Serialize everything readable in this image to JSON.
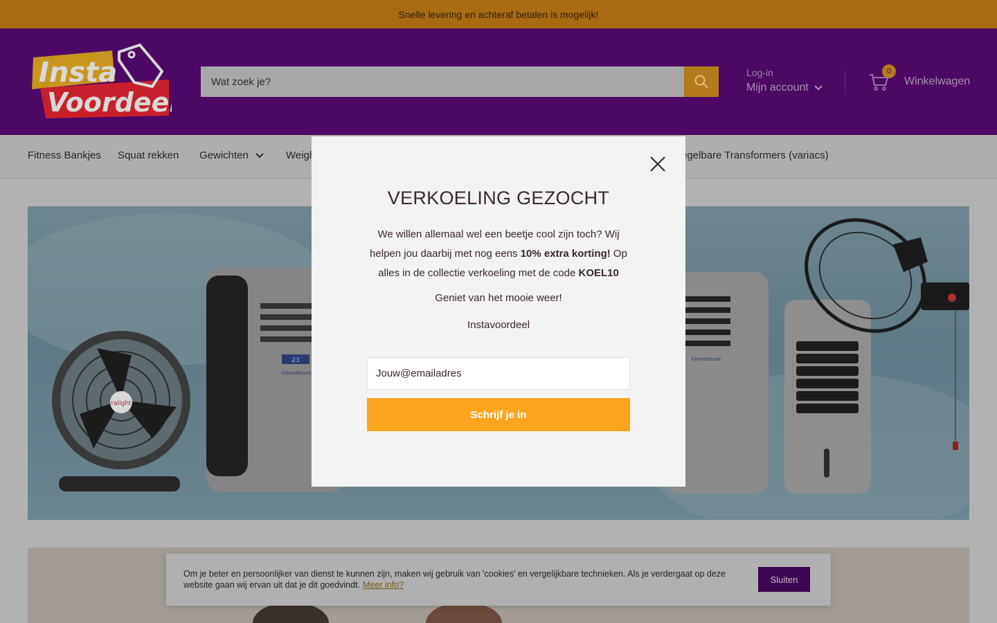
{
  "announcement": "Snelle levering en achteraf betalen is mogelijk!",
  "header": {
    "logo_top": "Insta",
    "logo_bottom": "Voordeel",
    "search_placeholder": "Wat zoek je?",
    "account_login": "Log-in",
    "account_label": "Mijn account",
    "cart_count": "0",
    "cart_label": "Winkelwagen"
  },
  "nav": {
    "items": [
      {
        "label": "Fitness Bankjes"
      },
      {
        "label": "Squat rekken"
      },
      {
        "label": "Gewichten"
      },
      {
        "label": "Weigh"
      },
      {
        "label": "egelbare Transformers (variacs)"
      }
    ]
  },
  "modal": {
    "title": "VERKOELING GEZOCHT",
    "body_1": "We willen allemaal wel een beetje cool zijn toch? Wij helpen jou daarbij met nog eens ",
    "body_bold": "10% extra korting!",
    "body_2": " Op alles in de collectie verkoeling met de code ",
    "code": "KOEL10",
    "line_2": "Geniet van het mooie weer!",
    "line_3": "Instavoordeel",
    "email_placeholder": "Jouw@emailadres",
    "subscribe_label": "Schrijf je in"
  },
  "hero_labels": {
    "fan_brand": "ralight",
    "display": "23",
    "brand_left": "klimadeluxe",
    "brand_right": "klimadeluxe"
  },
  "cookie": {
    "text": "Om je beter en persoonlijker van dienst te kunnen zijn, maken wij gebruik van 'cookies' en vergelijkbare technieken. Als je verdergaat op deze website gaan wij ervan uit dat je dit goedvindt.",
    "link": "Meer info?",
    "button": "Sluiten"
  },
  "colors": {
    "announcement_bg": "#a96a13",
    "header_bg": "#4d0765",
    "accent": "#fda51e",
    "cookie_button": "#3d0652"
  }
}
